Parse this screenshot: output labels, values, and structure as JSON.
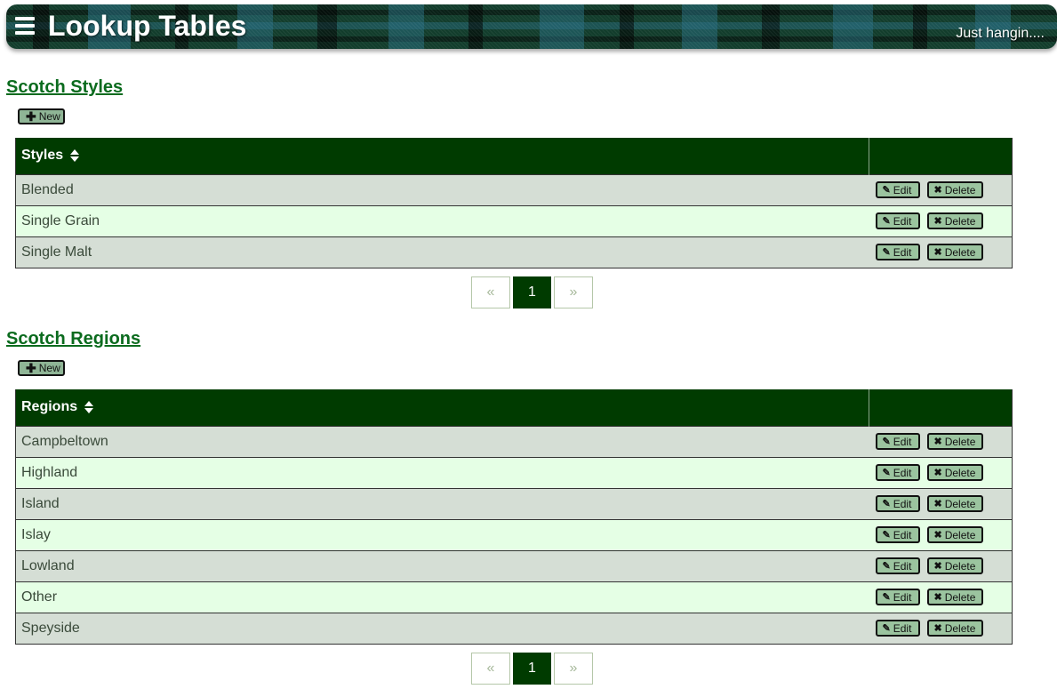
{
  "header": {
    "title": "Lookup Tables",
    "tagline": "Just hangin....",
    "menu_icon": "hamburger-menu-icon"
  },
  "sections": [
    {
      "title": "Scotch Styles",
      "new_label": "New",
      "column_header": "Styles",
      "rows": [
        "Blended",
        "Single Grain",
        "Single Malt"
      ],
      "edit_label": "Edit",
      "delete_label": "Delete",
      "pagination": {
        "prev": "«",
        "current": "1",
        "next": "»"
      }
    },
    {
      "title": "Scotch Regions",
      "new_label": "New",
      "column_header": "Regions",
      "rows": [
        "Campbeltown",
        "Highland",
        "Island",
        "Islay",
        "Lowland",
        "Other",
        "Speyside"
      ],
      "edit_label": "Edit",
      "delete_label": "Delete",
      "pagination": {
        "prev": "«",
        "current": "1",
        "next": "»"
      }
    }
  ],
  "colors": {
    "header_dark": "#003b00",
    "title_green": "#0b6b1e",
    "row_odd": "#d5ded5",
    "row_even": "#e5ffe5",
    "button_green": "#9bc49f"
  }
}
